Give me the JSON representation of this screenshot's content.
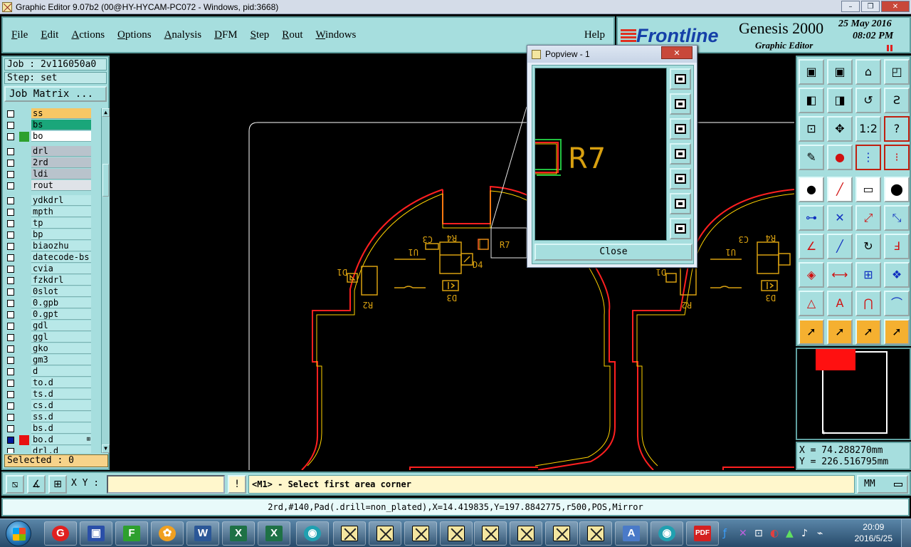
{
  "window": {
    "title": "Graphic Editor 9.07b2 (00@HY-HYCAM-PC072 - Windows, pid:3668)",
    "controls": [
      "–",
      "❐",
      "✕"
    ]
  },
  "menu": {
    "items": [
      "File",
      "Edit",
      "Actions",
      "Options",
      "Analysis",
      "DFM",
      "Step",
      "Rout",
      "Windows"
    ],
    "help": "Help"
  },
  "brand": {
    "logo": "Frontline",
    "product": "Genesis 2000",
    "subtitle": "Graphic Editor",
    "date": "25 May 2016",
    "time": "08:02 PM"
  },
  "left": {
    "job": "Job : 2v116050a0",
    "step": "Step: set",
    "job_matrix": "Job Matrix ...",
    "selected": "Selected : 0"
  },
  "layers": [
    {
      "name": "ss",
      "color": "#f7c765",
      "swatch": ""
    },
    {
      "name": "bs",
      "color": "#1aa67a",
      "swatch": ""
    },
    {
      "name": "bo",
      "color": "#ffffff",
      "swatch": "#2ea02e"
    },
    {
      "sep": true
    },
    {
      "name": "drl",
      "color": "#b9c3cc",
      "swatch": ""
    },
    {
      "name": "2rd",
      "color": "#b9c3cc",
      "swatch": ""
    },
    {
      "name": "ldi",
      "color": "#b9c3cc",
      "swatch": ""
    },
    {
      "name": "rout",
      "color": "#dfe3e8",
      "swatch": ""
    },
    {
      "sep": true
    },
    {
      "name": "ydkdrl",
      "color": "#b8e8e8",
      "swatch": ""
    },
    {
      "name": "mpth",
      "color": "#b8e8e8",
      "swatch": ""
    },
    {
      "name": "tp",
      "color": "#b8e8e8",
      "swatch": ""
    },
    {
      "name": "bp",
      "color": "#b8e8e8",
      "swatch": ""
    },
    {
      "name": "biaozhu",
      "color": "#b8e8e8",
      "swatch": ""
    },
    {
      "name": "datecode-bs",
      "color": "#b8e8e8",
      "swatch": ""
    },
    {
      "name": "cvia",
      "color": "#b8e8e8",
      "swatch": ""
    },
    {
      "name": "fzkdrl",
      "color": "#b8e8e8",
      "swatch": ""
    },
    {
      "name": "0slot",
      "color": "#b8e8e8",
      "swatch": ""
    },
    {
      "name": "0.gpb",
      "color": "#b8e8e8",
      "swatch": ""
    },
    {
      "name": "0.gpt",
      "color": "#b8e8e8",
      "swatch": ""
    },
    {
      "name": "gdl",
      "color": "#b8e8e8",
      "swatch": ""
    },
    {
      "name": "ggl",
      "color": "#b8e8e8",
      "swatch": ""
    },
    {
      "name": "gko",
      "color": "#b8e8e8",
      "swatch": ""
    },
    {
      "name": "gm3",
      "color": "#b8e8e8",
      "swatch": ""
    },
    {
      "name": "d",
      "color": "#b8e8e8",
      "swatch": ""
    },
    {
      "name": "to.d",
      "color": "#b8e8e8",
      "swatch": ""
    },
    {
      "name": "ts.d",
      "color": "#b8e8e8",
      "swatch": ""
    },
    {
      "name": "cs.d",
      "color": "#b8e8e8",
      "swatch": ""
    },
    {
      "name": "ss.d",
      "color": "#b8e8e8",
      "swatch": ""
    },
    {
      "name": "bs.d",
      "color": "#b8e8e8",
      "swatch": ""
    },
    {
      "name": "bo.d",
      "color": "#b8e8e8",
      "swatch": "#e81010",
      "checked": true,
      "dots": "⊞"
    },
    {
      "name": "drl.d",
      "color": "#b8e8e8",
      "swatch": ""
    }
  ],
  "canvas_labels": {
    "u1": "U1",
    "d1": "D1",
    "r2": "R2",
    "r4": "R4",
    "d3": "D3",
    "d4": "D4",
    "c3": "C3",
    "r7": "R7"
  },
  "popview": {
    "title": "Popview - 1",
    "zoom_label": "R7",
    "close_label": "Close"
  },
  "coords": {
    "x": "X =  74.288270mm",
    "y": "Y = 226.516795mm"
  },
  "command": {
    "xy_label": "X Y :",
    "xy_value": "",
    "prompt": "<M1> - Select first area corner",
    "units": "MM"
  },
  "status": "2rd,#140,Pad(.drill=non_plated),X=14.419835,Y=197.8842775,r500,POS,Mirror",
  "taskbar": {
    "time": "20:09",
    "date": "2016/5/25"
  },
  "colors": {
    "panel": "#a6dede",
    "profile": "#ffffff",
    "rout_red": "#ff2020",
    "silk_yellow": "#ffd200",
    "accent_orange": "#f5b030"
  }
}
